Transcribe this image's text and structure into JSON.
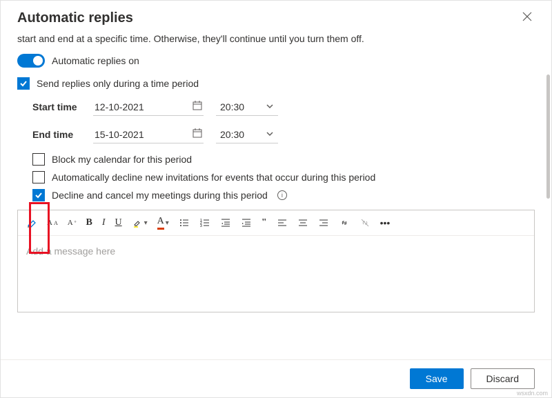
{
  "dialog": {
    "title": "Automatic replies",
    "description": "start and end at a specific time. Otherwise, they'll continue until you turn them off."
  },
  "toggle": {
    "label": "Automatic replies on",
    "on": true
  },
  "sendPeriod": {
    "label": "Send replies only during a time period",
    "checked": true
  },
  "times": {
    "startLabel": "Start time",
    "endLabel": "End time",
    "startDate": "12-10-2021",
    "endDate": "15-10-2021",
    "startTime": "20:30",
    "endTime": "20:30"
  },
  "options": {
    "block": {
      "label": "Block my calendar for this period",
      "checked": false
    },
    "decline": {
      "label": "Automatically decline new invitations for events that occur during this period",
      "checked": false
    },
    "cancel": {
      "label": "Decline and cancel my meetings during this period",
      "checked": true
    }
  },
  "editor": {
    "placeholder": "Add a message here"
  },
  "footer": {
    "save": "Save",
    "discard": "Discard"
  },
  "watermark": "wsxdn.com"
}
